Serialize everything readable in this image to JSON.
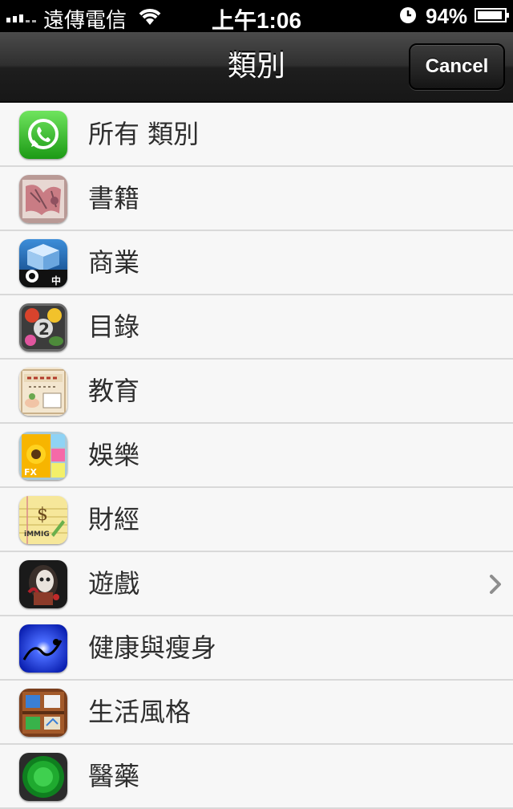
{
  "status_bar": {
    "carrier": "遠傳電信",
    "time": "上午1:06",
    "battery": "94%",
    "battery_level": 0.94,
    "icons": [
      "signal-icon",
      "wifi-icon",
      "alarm-icon",
      "battery-icon"
    ]
  },
  "nav": {
    "title": "類別",
    "cancel_label": "Cancel"
  },
  "categories": [
    {
      "label": "所有 類別",
      "icon": "whatsapp-app-icon"
    },
    {
      "label": "書籍",
      "icon": "book-app-icon"
    },
    {
      "label": "商業",
      "icon": "camera-app-icon"
    },
    {
      "label": "目錄",
      "icon": "games-catalog-app-icon"
    },
    {
      "label": "教育",
      "icon": "nature-book-app-icon"
    },
    {
      "label": "娛樂",
      "icon": "photo-fx-app-icon"
    },
    {
      "label": "財經",
      "icon": "immig-notepad-app-icon"
    },
    {
      "label": "遊戲",
      "icon": "horror-game-app-icon",
      "chevron": true
    },
    {
      "label": "健康與瘦身",
      "icon": "blue-burst-app-icon"
    },
    {
      "label": "生活風格",
      "icon": "wooden-shelf-app-icon"
    },
    {
      "label": "醫藥",
      "icon": "green-radar-app-icon"
    }
  ],
  "colors": {
    "nav_dark": "#1e1e1e",
    "list_bg": "#f7f7f7",
    "separator": "#d9d9d9",
    "label": "#2e2e2e"
  }
}
